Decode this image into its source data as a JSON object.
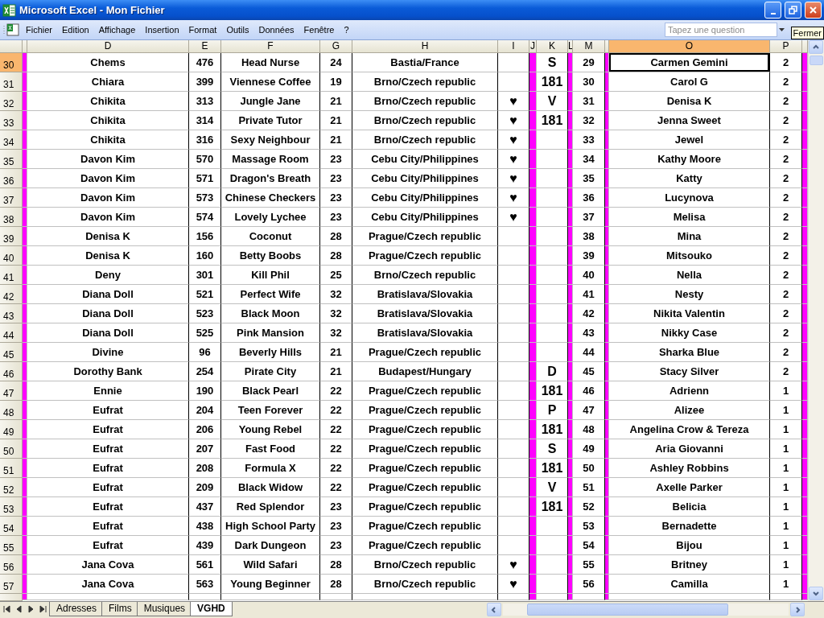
{
  "window": {
    "title": "Microsoft Excel - Mon Fichier"
  },
  "menu": [
    "Fichier",
    "Edition",
    "Affichage",
    "Insertion",
    "Format",
    "Outils",
    "Données",
    "Fenêtre",
    "?"
  ],
  "help_search": {
    "placeholder": "Tapez une question"
  },
  "tooltip": "Fermer",
  "columns": [
    {
      "kind": "marker",
      "selected": false
    },
    {
      "kind": "data",
      "label": "D",
      "selected": false
    },
    {
      "kind": "data",
      "label": "E",
      "selected": false
    },
    {
      "kind": "data",
      "label": "F",
      "selected": false
    },
    {
      "kind": "data",
      "label": "G",
      "selected": false
    },
    {
      "kind": "data",
      "label": "H",
      "selected": false
    },
    {
      "kind": "data",
      "label": "I",
      "selected": false
    },
    {
      "kind": "marker",
      "label": "J",
      "selected": false
    },
    {
      "kind": "data",
      "label": "K",
      "selected": false
    },
    {
      "kind": "marker",
      "label": "L",
      "selected": false
    },
    {
      "kind": "data",
      "label": "M",
      "selected": false
    },
    {
      "kind": "marker",
      "selected": false
    },
    {
      "kind": "data",
      "label": "O",
      "selected": true
    },
    {
      "kind": "data",
      "label": "P",
      "selected": false
    },
    {
      "kind": "marker",
      "selected": false
    }
  ],
  "rows": [
    {
      "number": "30",
      "selected": true,
      "d": "Chems",
      "e": "476",
      "f": "Head Nurse",
      "g": "24",
      "h": "Bastia/France",
      "k": "S",
      "m": "29",
      "o": "Carmen Gemini",
      "p": "2"
    },
    {
      "number": "31",
      "selected": false,
      "d": "Chiara",
      "e": "399",
      "f": "Viennese Coffee",
      "g": "19",
      "h": "Brno/Czech republic",
      "k": "181",
      "m": "30",
      "o": "Carol G",
      "p": "2"
    },
    {
      "number": "32",
      "selected": false,
      "d": "Chikita",
      "e": "313",
      "f": "Jungle Jane",
      "g": "21",
      "h": "Brno/Czech republic",
      "i": "♥",
      "k": "V",
      "m": "31",
      "o": "Denisa K",
      "p": "2"
    },
    {
      "number": "33",
      "selected": false,
      "d": "Chikita",
      "e": "314",
      "f": "Private Tutor",
      "g": "21",
      "h": "Brno/Czech republic",
      "i": "♥",
      "k": "181",
      "m": "32",
      "o": "Jenna Sweet",
      "p": "2"
    },
    {
      "number": "34",
      "selected": false,
      "d": "Chikita",
      "e": "316",
      "f": "Sexy Neighbour",
      "g": "21",
      "h": "Brno/Czech republic",
      "i": "♥",
      "m": "33",
      "o": "Jewel",
      "p": "2"
    },
    {
      "number": "35",
      "selected": false,
      "d": "Davon Kim",
      "e": "570",
      "f": "Massage Room",
      "g": "23",
      "h": "Cebu City/Philippines",
      "i": "♥",
      "m": "34",
      "o": "Kathy Moore",
      "p": "2"
    },
    {
      "number": "36",
      "selected": false,
      "d": "Davon Kim",
      "e": "571",
      "f": "Dragon's Breath",
      "g": "23",
      "h": "Cebu City/Philippines",
      "i": "♥",
      "m": "35",
      "o": "Katty",
      "p": "2"
    },
    {
      "number": "37",
      "selected": false,
      "d": "Davon Kim",
      "e": "573",
      "f": "Chinese Checkers",
      "g": "23",
      "h": "Cebu City/Philippines",
      "i": "♥",
      "m": "36",
      "o": "Lucynova",
      "p": "2"
    },
    {
      "number": "38",
      "selected": false,
      "d": "Davon Kim",
      "e": "574",
      "f": "Lovely Lychee",
      "g": "23",
      "h": "Cebu City/Philippines",
      "i": "♥",
      "m": "37",
      "o": "Melisa",
      "p": "2"
    },
    {
      "number": "39",
      "selected": false,
      "d": "Denisa K",
      "e": "156",
      "f": "Coconut",
      "g": "28",
      "h": "Prague/Czech republic",
      "m": "38",
      "o": "Mina",
      "p": "2"
    },
    {
      "number": "40",
      "selected": false,
      "d": "Denisa K",
      "e": "160",
      "f": "Betty Boobs",
      "g": "28",
      "h": "Prague/Czech republic",
      "m": "39",
      "o": "Mitsouko",
      "p": "2"
    },
    {
      "number": "41",
      "selected": false,
      "d": "Deny",
      "e": "301",
      "f": "Kill Phil",
      "g": "25",
      "h": "Brno/Czech republic",
      "m": "40",
      "o": "Nella",
      "p": "2"
    },
    {
      "number": "42",
      "selected": false,
      "d": "Diana Doll",
      "e": "521",
      "f": "Perfect Wife",
      "g": "32",
      "h": "Bratislava/Slovakia",
      "m": "41",
      "o": "Nesty",
      "p": "2"
    },
    {
      "number": "43",
      "selected": false,
      "d": "Diana Doll",
      "e": "523",
      "f": "Black Moon",
      "g": "32",
      "h": "Bratislava/Slovakia",
      "m": "42",
      "o": "Nikita Valentin",
      "p": "2"
    },
    {
      "number": "44",
      "selected": false,
      "d": "Diana Doll",
      "e": "525",
      "f": "Pink Mansion",
      "g": "32",
      "h": "Bratislava/Slovakia",
      "m": "43",
      "o": "Nikky Case",
      "p": "2"
    },
    {
      "number": "45",
      "selected": false,
      "d": "Divine",
      "e": "96",
      "f": "Beverly Hills",
      "g": "21",
      "h": "Prague/Czech republic",
      "m": "44",
      "o": "Sharka Blue",
      "p": "2"
    },
    {
      "number": "46",
      "selected": false,
      "d": "Dorothy Bank",
      "e": "254",
      "f": "Pirate City",
      "g": "21",
      "h": "Budapest/Hungary",
      "k": "D",
      "m": "45",
      "o": "Stacy Silver",
      "p": "2"
    },
    {
      "number": "47",
      "selected": false,
      "d": "Ennie",
      "e": "190",
      "f": "Black Pearl",
      "g": "22",
      "h": "Prague/Czech republic",
      "k": "181",
      "m": "46",
      "o": "Adrienn",
      "p": "1"
    },
    {
      "number": "48",
      "selected": false,
      "d": "Eufrat",
      "e": "204",
      "f": "Teen Forever",
      "g": "22",
      "h": "Prague/Czech republic",
      "k": "P",
      "m": "47",
      "o": "Alizee",
      "p": "1"
    },
    {
      "number": "49",
      "selected": false,
      "d": "Eufrat",
      "e": "206",
      "f": "Young Rebel",
      "g": "22",
      "h": "Prague/Czech republic",
      "k": "181",
      "m": "48",
      "o": "Angelina Crow & Tereza",
      "p": "1"
    },
    {
      "number": "50",
      "selected": false,
      "d": "Eufrat",
      "e": "207",
      "f": "Fast Food",
      "g": "22",
      "h": "Prague/Czech republic",
      "k": "S",
      "m": "49",
      "o": "Aria Giovanni",
      "p": "1"
    },
    {
      "number": "51",
      "selected": false,
      "d": "Eufrat",
      "e": "208",
      "f": "Formula X",
      "g": "22",
      "h": "Prague/Czech republic",
      "k": "181",
      "m": "50",
      "o": "Ashley Robbins",
      "p": "1"
    },
    {
      "number": "52",
      "selected": false,
      "d": "Eufrat",
      "e": "209",
      "f": "Black Widow",
      "g": "22",
      "h": "Prague/Czech republic",
      "k": "V",
      "m": "51",
      "o": "Axelle Parker",
      "p": "1"
    },
    {
      "number": "53",
      "selected": false,
      "d": "Eufrat",
      "e": "437",
      "f": "Red Splendor",
      "g": "23",
      "h": "Prague/Czech republic",
      "k": "181",
      "m": "52",
      "o": "Belicia",
      "p": "1"
    },
    {
      "number": "54",
      "selected": false,
      "d": "Eufrat",
      "e": "438",
      "f": "High School Party",
      "g": "23",
      "h": "Prague/Czech republic",
      "m": "53",
      "o": "Bernadette",
      "p": "1"
    },
    {
      "number": "55",
      "selected": false,
      "d": "Eufrat",
      "e": "439",
      "f": "Dark Dungeon",
      "g": "23",
      "h": "Prague/Czech republic",
      "m": "54",
      "o": "Bijou",
      "p": "1"
    },
    {
      "number": "56",
      "selected": false,
      "d": "Jana Cova",
      "e": "561",
      "f": "Wild Safari",
      "g": "28",
      "h": "Brno/Czech republic",
      "i": "♥",
      "m": "55",
      "o": "Britney",
      "p": "1"
    },
    {
      "number": "57",
      "selected": false,
      "d": "Jana Cova",
      "e": "563",
      "f": "Young Beginner",
      "g": "28",
      "h": "Brno/Czech republic",
      "i": "♥",
      "m": "56",
      "o": "Camilla",
      "p": "1"
    }
  ],
  "sheet_tabs": [
    {
      "label": "Adresses",
      "selected": false
    },
    {
      "label": "Films",
      "selected": false
    },
    {
      "label": "Musiques",
      "selected": false
    },
    {
      "label": "VGHD",
      "selected": true
    }
  ]
}
